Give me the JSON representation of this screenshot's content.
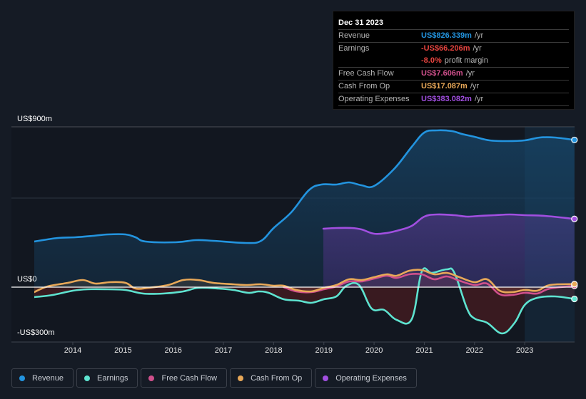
{
  "chart_data": {
    "type": "line",
    "title": "",
    "xlabel": "",
    "ylabel": "",
    "x_ticks": [
      "2014",
      "2015",
      "2016",
      "2017",
      "2018",
      "2019",
      "2020",
      "2021",
      "2022",
      "2023"
    ],
    "y_ticks": [
      "US$900m",
      "US$0",
      "-US$300m"
    ],
    "y_tick_values": [
      900,
      0,
      -300
    ],
    "ylim": [
      -300,
      900
    ],
    "xlim": [
      2013.23,
      2023.99
    ],
    "grid": true,
    "forecast_shade_start": 2023.0,
    "legend_position": "bottom",
    "units": "US$m",
    "series": [
      {
        "name": "Revenue",
        "color": "#2394df",
        "points": [
          [
            2013.23,
            256
          ],
          [
            2013.7,
            276
          ],
          [
            2014.05,
            280
          ],
          [
            2014.4,
            288
          ],
          [
            2014.7,
            296
          ],
          [
            2015.05,
            296
          ],
          [
            2015.25,
            280
          ],
          [
            2015.45,
            256
          ],
          [
            2016.05,
            252
          ],
          [
            2016.45,
            264
          ],
          [
            2016.8,
            260
          ],
          [
            2017.45,
            248
          ],
          [
            2017.75,
            260
          ],
          [
            2018.0,
            332
          ],
          [
            2018.35,
            420
          ],
          [
            2018.7,
            544
          ],
          [
            2018.95,
            576
          ],
          [
            2019.25,
            576
          ],
          [
            2019.5,
            588
          ],
          [
            2019.75,
            572
          ],
          [
            2020.0,
            568
          ],
          [
            2020.4,
            664
          ],
          [
            2020.75,
            788
          ],
          [
            2021.0,
            868
          ],
          [
            2021.25,
            880
          ],
          [
            2021.55,
            876
          ],
          [
            2021.75,
            860
          ],
          [
            2022.0,
            844
          ],
          [
            2022.3,
            824
          ],
          [
            2022.65,
            820
          ],
          [
            2023.0,
            824
          ],
          [
            2023.3,
            840
          ],
          [
            2023.6,
            840
          ],
          [
            2023.99,
            826.339
          ]
        ]
      },
      {
        "name": "Earnings",
        "color": "#5ee3d0",
        "points": [
          [
            2013.23,
            -56
          ],
          [
            2013.6,
            -44
          ],
          [
            2014.0,
            -20
          ],
          [
            2014.3,
            -12
          ],
          [
            2014.7,
            -12
          ],
          [
            2015.05,
            -16
          ],
          [
            2015.4,
            -36
          ],
          [
            2015.8,
            -36
          ],
          [
            2016.2,
            -24
          ],
          [
            2016.5,
            -4
          ],
          [
            2016.9,
            -8
          ],
          [
            2017.2,
            -16
          ],
          [
            2017.5,
            -32
          ],
          [
            2017.7,
            -24
          ],
          [
            2017.9,
            -32
          ],
          [
            2018.2,
            -68
          ],
          [
            2018.5,
            -76
          ],
          [
            2018.75,
            -88
          ],
          [
            2019.0,
            -68
          ],
          [
            2019.25,
            -52
          ],
          [
            2019.45,
            8
          ],
          [
            2019.7,
            12
          ],
          [
            2019.95,
            -120
          ],
          [
            2020.2,
            -128
          ],
          [
            2020.45,
            -184
          ],
          [
            2020.75,
            -180
          ],
          [
            2020.95,
            88
          ],
          [
            2021.15,
            80
          ],
          [
            2021.45,
            100
          ],
          [
            2021.6,
            80
          ],
          [
            2021.85,
            -120
          ],
          [
            2022.0,
            -176
          ],
          [
            2022.25,
            -200
          ],
          [
            2022.55,
            -260
          ],
          [
            2022.8,
            -200
          ],
          [
            2023.0,
            -100
          ],
          [
            2023.25,
            -60
          ],
          [
            2023.6,
            -52
          ],
          [
            2023.99,
            -66.206
          ]
        ]
      },
      {
        "name": "Free Cash Flow",
        "color": "#d0508c",
        "points": [
          [
            2018.2,
            0
          ],
          [
            2018.45,
            -24
          ],
          [
            2018.75,
            -28
          ],
          [
            2019.0,
            -12
          ],
          [
            2019.25,
            4
          ],
          [
            2019.5,
            32
          ],
          [
            2019.75,
            32
          ],
          [
            2020.0,
            48
          ],
          [
            2020.25,
            64
          ],
          [
            2020.45,
            52
          ],
          [
            2020.7,
            72
          ],
          [
            2020.95,
            72
          ],
          [
            2021.2,
            44
          ],
          [
            2021.45,
            60
          ],
          [
            2021.7,
            36
          ],
          [
            2022.0,
            12
          ],
          [
            2022.25,
            20
          ],
          [
            2022.5,
            -40
          ],
          [
            2022.75,
            -44
          ],
          [
            2023.0,
            -32
          ],
          [
            2023.25,
            -36
          ],
          [
            2023.5,
            -8
          ],
          [
            2023.99,
            7.606
          ]
        ]
      },
      {
        "name": "Cash From Op",
        "color": "#e8a858",
        "points": [
          [
            2013.23,
            -28
          ],
          [
            2013.5,
            4
          ],
          [
            2013.9,
            24
          ],
          [
            2014.2,
            40
          ],
          [
            2014.45,
            20
          ],
          [
            2014.75,
            28
          ],
          [
            2015.05,
            24
          ],
          [
            2015.25,
            -8
          ],
          [
            2015.5,
            -4
          ],
          [
            2015.9,
            12
          ],
          [
            2016.2,
            40
          ],
          [
            2016.5,
            40
          ],
          [
            2016.8,
            24
          ],
          [
            2017.2,
            16
          ],
          [
            2017.45,
            12
          ],
          [
            2017.75,
            16
          ],
          [
            2018.0,
            8
          ],
          [
            2018.2,
            8
          ],
          [
            2018.45,
            -16
          ],
          [
            2018.75,
            -24
          ],
          [
            2019.0,
            -4
          ],
          [
            2019.25,
            12
          ],
          [
            2019.5,
            44
          ],
          [
            2019.75,
            40
          ],
          [
            2020.0,
            56
          ],
          [
            2020.25,
            72
          ],
          [
            2020.45,
            64
          ],
          [
            2020.7,
            92
          ],
          [
            2020.95,
            96
          ],
          [
            2021.2,
            72
          ],
          [
            2021.45,
            80
          ],
          [
            2021.7,
            56
          ],
          [
            2022.0,
            28
          ],
          [
            2022.25,
            44
          ],
          [
            2022.5,
            -20
          ],
          [
            2022.75,
            -28
          ],
          [
            2023.0,
            -16
          ],
          [
            2023.25,
            -20
          ],
          [
            2023.5,
            12
          ],
          [
            2023.99,
            17.087
          ]
        ]
      },
      {
        "name": "Operating Expenses",
        "color": "#a14fe0",
        "points": [
          [
            2018.99,
            328
          ],
          [
            2019.25,
            332
          ],
          [
            2019.55,
            332
          ],
          [
            2019.75,
            324
          ],
          [
            2020.0,
            300
          ],
          [
            2020.25,
            304
          ],
          [
            2020.5,
            320
          ],
          [
            2020.75,
            344
          ],
          [
            2021.0,
            396
          ],
          [
            2021.25,
            408
          ],
          [
            2021.6,
            404
          ],
          [
            2021.85,
            396
          ],
          [
            2022.1,
            400
          ],
          [
            2022.4,
            404
          ],
          [
            2022.7,
            408
          ],
          [
            2023.0,
            404
          ],
          [
            2023.4,
            400
          ],
          [
            2023.99,
            383.082
          ]
        ]
      }
    ]
  },
  "tooltip": {
    "date": "Dec 31 2023",
    "rows": [
      {
        "label": "Revenue",
        "value": "US$826.339m",
        "unit": "/yr",
        "color": "#2394df"
      },
      {
        "label": "Earnings",
        "value": "-US$66.206m",
        "unit": "/yr",
        "color": "#e8443f"
      },
      {
        "label": "",
        "value": "-8.0%",
        "unit": "profit margin",
        "color": "#e8443f"
      },
      {
        "label": "Free Cash Flow",
        "value": "US$7.606m",
        "unit": "/yr",
        "color": "#d0508c"
      },
      {
        "label": "Cash From Op",
        "value": "US$17.087m",
        "unit": "/yr",
        "color": "#e8a858"
      },
      {
        "label": "Operating Expenses",
        "value": "US$383.082m",
        "unit": "/yr",
        "color": "#a14fe0"
      }
    ]
  },
  "legend": [
    {
      "label": "Revenue",
      "color": "#2394df"
    },
    {
      "label": "Earnings",
      "color": "#5ee3d0"
    },
    {
      "label": "Free Cash Flow",
      "color": "#d0508c"
    },
    {
      "label": "Cash From Op",
      "color": "#e8a858"
    },
    {
      "label": "Operating Expenses",
      "color": "#a14fe0"
    }
  ]
}
